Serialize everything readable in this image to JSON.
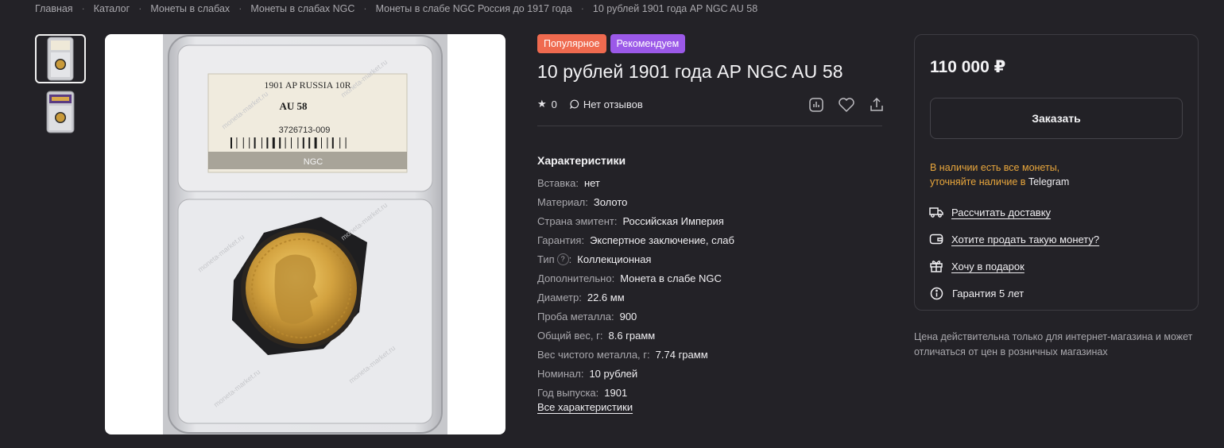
{
  "breadcrumbs": [
    "Главная",
    "Каталог",
    "Монеты в слабах",
    "Монеты в слабах NGC",
    "Монеты в слабе NGC Россия до 1917 года",
    "10 рублей 1901 года АР NGC AU 58"
  ],
  "gallery": {
    "slab_label_line1": "1901 AP RUSSIA 10R",
    "slab_grade": "AU 58",
    "slab_cert": "3726713-009",
    "slab_brand": "NGC",
    "watermark": "moneta-market.ru"
  },
  "badges": {
    "popular": "Популярное",
    "recommended": "Рекомендуем"
  },
  "product": {
    "title": "10 рублей 1901 года АР NGC AU 58",
    "rating": "0",
    "reviews": "Нет отзывов"
  },
  "specs": {
    "title": "Характеристики",
    "rows": [
      {
        "key": "Вставка",
        "value": "нет"
      },
      {
        "key": "Материал",
        "value": "Золото"
      },
      {
        "key": "Страна эмитент",
        "value": "Российская Империя"
      },
      {
        "key": "Гарантия",
        "value": "Экспертное заключение, слаб"
      },
      {
        "key": "Тип",
        "value": "Коллекционная",
        "help": "?"
      },
      {
        "key": "Дополнительно",
        "value": "Монета в слабе NGC"
      },
      {
        "key": "Диаметр",
        "value": "22.6 мм"
      },
      {
        "key": "Проба металла",
        "value": "900"
      },
      {
        "key": "Общий вес, г",
        "value": "8.6 грамм"
      },
      {
        "key": "Вес чистого металла, г",
        "value": "7.74 грамм"
      },
      {
        "key": "Номинал",
        "value": "10 рублей"
      },
      {
        "key": "Год выпуска",
        "value": "1901"
      }
    ],
    "all_link": "Все характеристики"
  },
  "buy": {
    "price": "110 000 ₽",
    "order_button": "Заказать",
    "stock_line1": "В наличии есть все монеты,",
    "stock_line2_prefix": "уточняйте наличие в ",
    "stock_line2_link": "Telegram",
    "links": {
      "delivery": "Рассчитать доставку",
      "sell": "Хотите продать такую монету?",
      "gift": "Хочу в подарок",
      "warranty": "Гарантия 5 лет"
    }
  },
  "price_note": "Цена действительна только для интернет-магазина и может отличаться от цен в розничных магазинах",
  "colors": {
    "background": "#232227",
    "popular_badge": "#ef6a4f",
    "recommended_badge": "#9b59e8",
    "stock_text": "#e8a63c"
  }
}
